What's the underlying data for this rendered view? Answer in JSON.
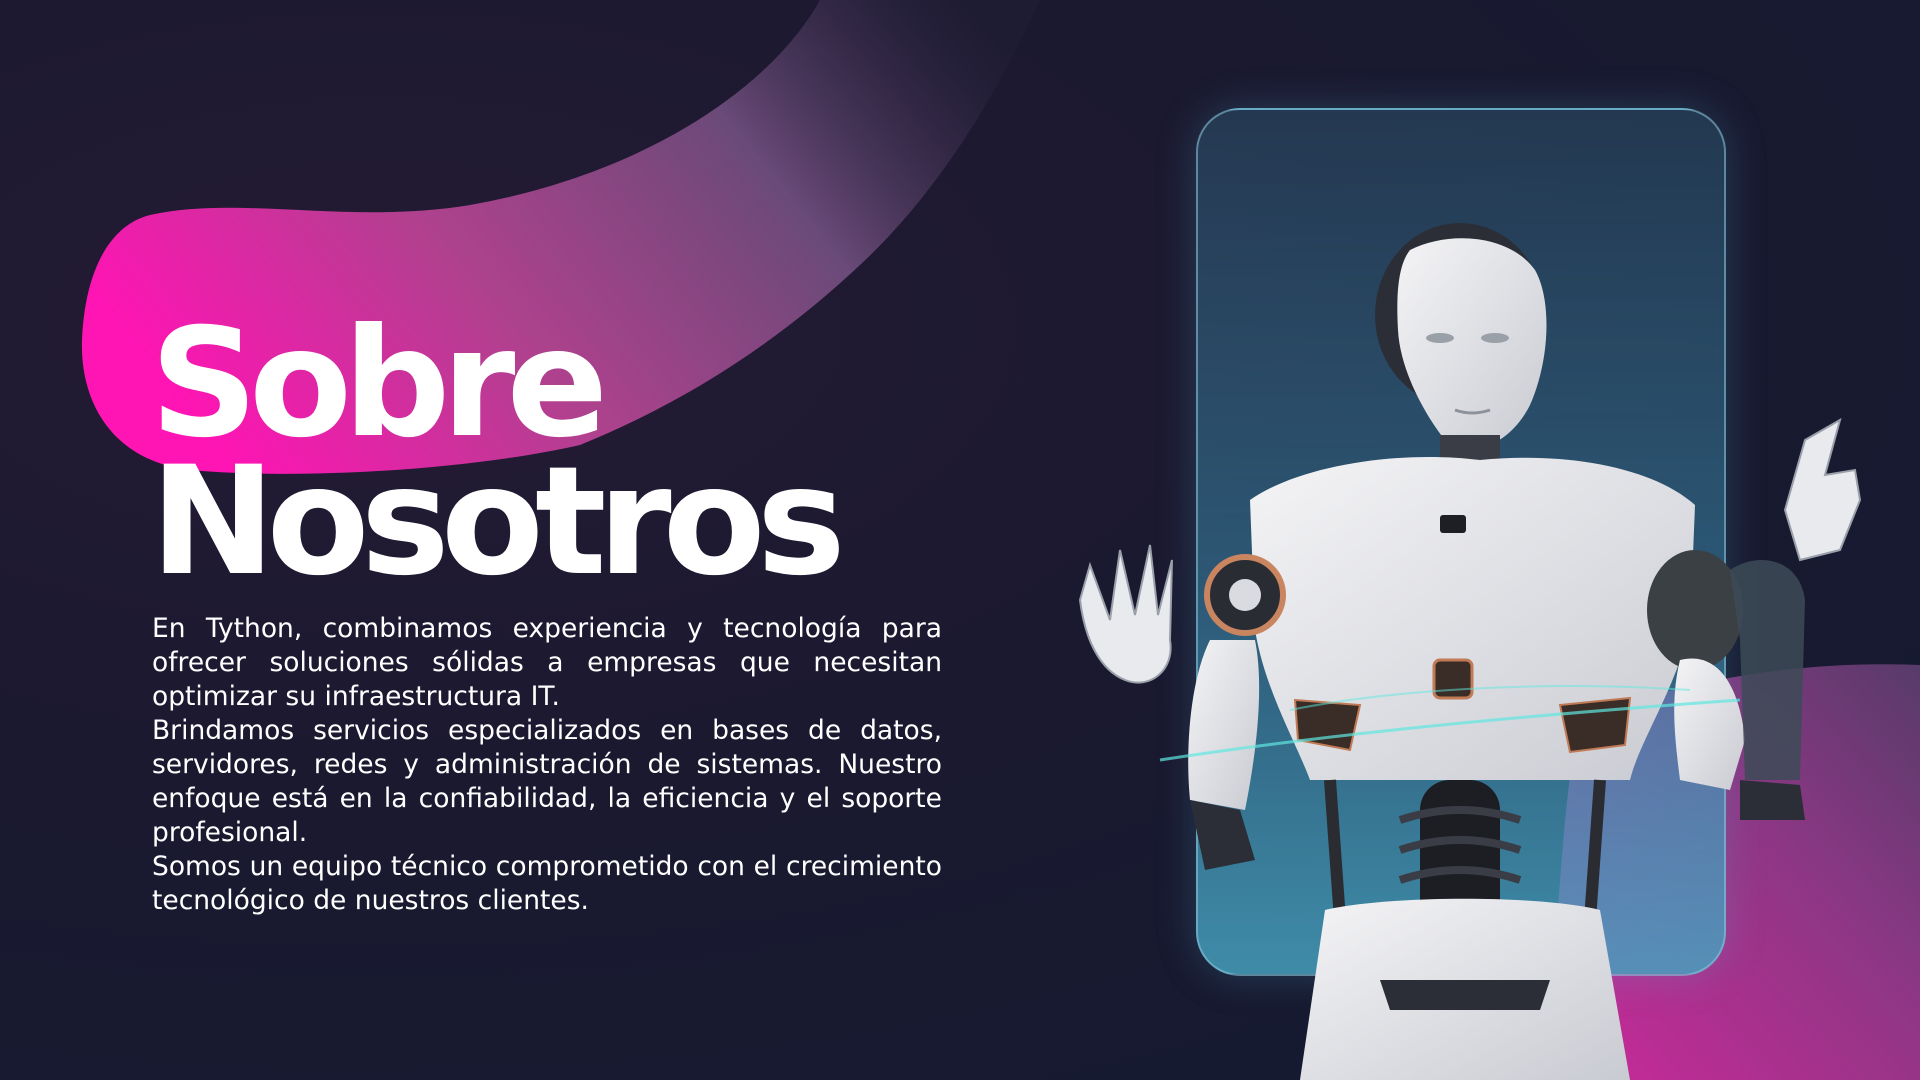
{
  "slide": {
    "title_line1": "Sobre",
    "title_line2": "Nosotros",
    "paragraphs": [
      "En Tython, combinamos experiencia y tecnología para ofrecer soluciones sólidas a empresas que necesitan optimizar su infraestructura IT.",
      "Brindamos servicios especializados en bases de datos, servidores, redes y administración de sistemas. Nuestro enfoque está en la confiabilidad, la eficiencia y el soporte profesional.",
      "Somos un equipo técnico comprometido con el crecimiento tecnológico de nuestros clientes."
    ]
  },
  "colors": {
    "background": "#1a1930",
    "accent_magenta": "#ff1fb4",
    "accent_mauve": "#7a4a86",
    "frame_teal": "#4b9fbd",
    "text": "#ffffff"
  }
}
